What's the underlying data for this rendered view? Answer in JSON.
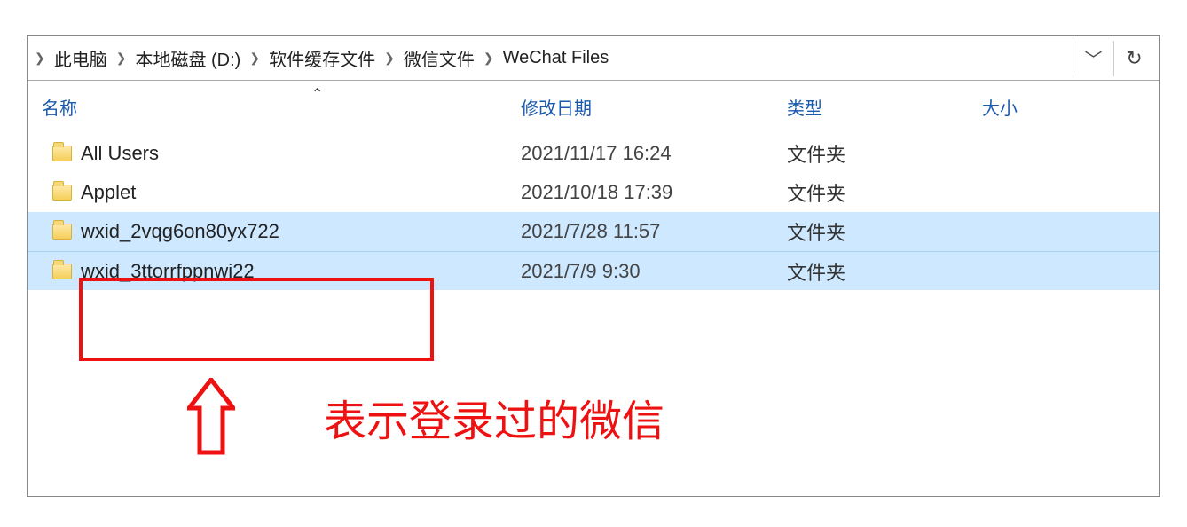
{
  "breadcrumb": {
    "items": [
      {
        "label": "此电脑"
      },
      {
        "label": "本地磁盘 (D:)"
      },
      {
        "label": "软件缓存文件"
      },
      {
        "label": "微信文件"
      },
      {
        "label": "WeChat Files"
      }
    ]
  },
  "columns": {
    "name": "名称",
    "date": "修改日期",
    "type": "类型",
    "size": "大小"
  },
  "files": [
    {
      "name": "All Users",
      "date": "2021/11/17 16:24",
      "type": "文件夹",
      "selected": false
    },
    {
      "name": "Applet",
      "date": "2021/10/18 17:39",
      "type": "文件夹",
      "selected": false
    },
    {
      "name": "wxid_2vqg6on80yx722",
      "date": "2021/7/28 11:57",
      "type": "文件夹",
      "selected": true
    },
    {
      "name": "wxid_3ttorrfppnwi22",
      "date": "2021/7/9 9:30",
      "type": "文件夹",
      "selected": true
    }
  ],
  "annotation": {
    "label": "表示登录过的微信"
  }
}
